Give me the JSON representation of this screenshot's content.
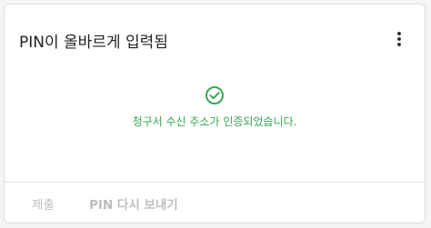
{
  "card": {
    "title": "PIN이 올바르게 입력됨",
    "menu_icon": "more-vert-icon",
    "status": {
      "icon": "check-circle-icon",
      "message": "청구서 수신 주소가 인증되었습니다.",
      "color": "#34a853"
    },
    "actions": {
      "submit_label": "제출",
      "resend_label": "PIN 다시 보내기"
    }
  }
}
